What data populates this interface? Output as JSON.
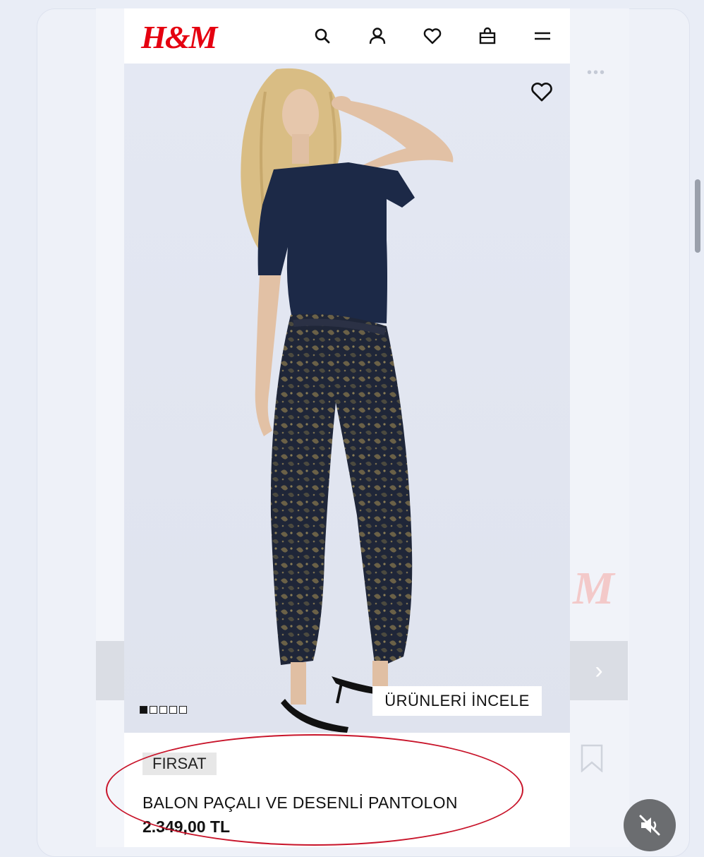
{
  "brand": {
    "logo_text": "H&M",
    "brand_color": "#e50010"
  },
  "header": {
    "icons": [
      "search-icon",
      "user-icon",
      "heart-icon",
      "bag-icon",
      "menu-icon"
    ]
  },
  "product": {
    "image_count": 5,
    "active_image": 1,
    "browse_label": "ÜRÜNLERİ İNCELE",
    "badge": "FIRSAT",
    "name": "BALON PAÇALI VE DESENLİ PANTOLON",
    "price": "2.349,00 TL"
  },
  "overlay": {
    "highlight_color": "#c8142a",
    "mute_icon": "speaker-muted-icon"
  }
}
